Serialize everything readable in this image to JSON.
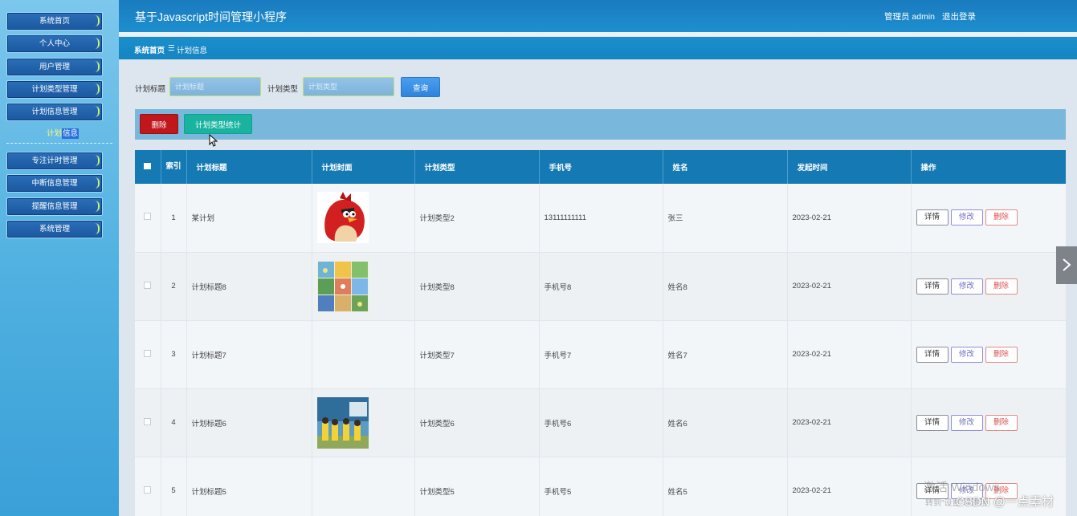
{
  "header": {
    "title": "基于Javascript时间管理小程序",
    "admin": "管理员 admin",
    "logout": "退出登录"
  },
  "sidebar": {
    "items": [
      {
        "label": "系统首页"
      },
      {
        "label": "个人中心"
      },
      {
        "label": "用户管理"
      },
      {
        "label": "计划类型管理"
      },
      {
        "label": "计划信息管理"
      },
      {
        "label": "专注计时管理"
      },
      {
        "label": "中断信息管理"
      },
      {
        "label": "提醒信息管理"
      },
      {
        "label": "系统管理"
      }
    ],
    "submenu": {
      "part1": "计划",
      "part2": "信息"
    }
  },
  "breadcrumb": {
    "home": "系统首页",
    "sep": "☰",
    "current": "计划信息"
  },
  "search": {
    "title_label": "计划标题",
    "title_placeholder": "计划标题",
    "type_label": "计划类型",
    "type_placeholder": "计划类型",
    "query_button": "查询"
  },
  "actions": {
    "delete": "删除",
    "stats": "计划类型统计"
  },
  "table": {
    "headers": {
      "index": "索引",
      "title": "计划标题",
      "cover": "计划封面",
      "type": "计划类型",
      "phone": "手机号",
      "name": "姓名",
      "time": "发起时间",
      "ops": "操作"
    },
    "op_labels": {
      "detail": "详情",
      "edit": "修改",
      "delete": "删除"
    },
    "rows": [
      {
        "index": "1",
        "title": "某计划",
        "cover": "red-bird-image",
        "type": "计划类型2",
        "phone": "13111111111",
        "name": "张三",
        "time": "2023-02-21"
      },
      {
        "index": "2",
        "title": "计划标题8",
        "cover": "grid-collage-image",
        "type": "计划类型8",
        "phone": "手机号8",
        "name": "姓名8",
        "time": "2023-02-21"
      },
      {
        "index": "3",
        "title": "计划标题7",
        "cover": "",
        "type": "计划类型7",
        "phone": "手机号7",
        "name": "姓名7",
        "time": "2023-02-21"
      },
      {
        "index": "4",
        "title": "计划标题6",
        "cover": "kids-photo-image",
        "type": "计划类型6",
        "phone": "手机号6",
        "name": "姓名6",
        "time": "2023-02-21"
      },
      {
        "index": "5",
        "title": "计划标题5",
        "cover": "",
        "type": "计划类型5",
        "phone": "手机号5",
        "name": "姓名5",
        "time": "2023-02-21"
      }
    ]
  },
  "watermarks": {
    "windows": "激活 Windows",
    "windows_sub": "转到\"设置\"以激活",
    "csdn": "CSDN @一点素材"
  },
  "colors": {
    "header": "#1a7bbf",
    "table_header": "#1579b3",
    "delete_button": "#c0171d",
    "stats_button": "#19b39f",
    "query_button": "#3b8fe6"
  }
}
